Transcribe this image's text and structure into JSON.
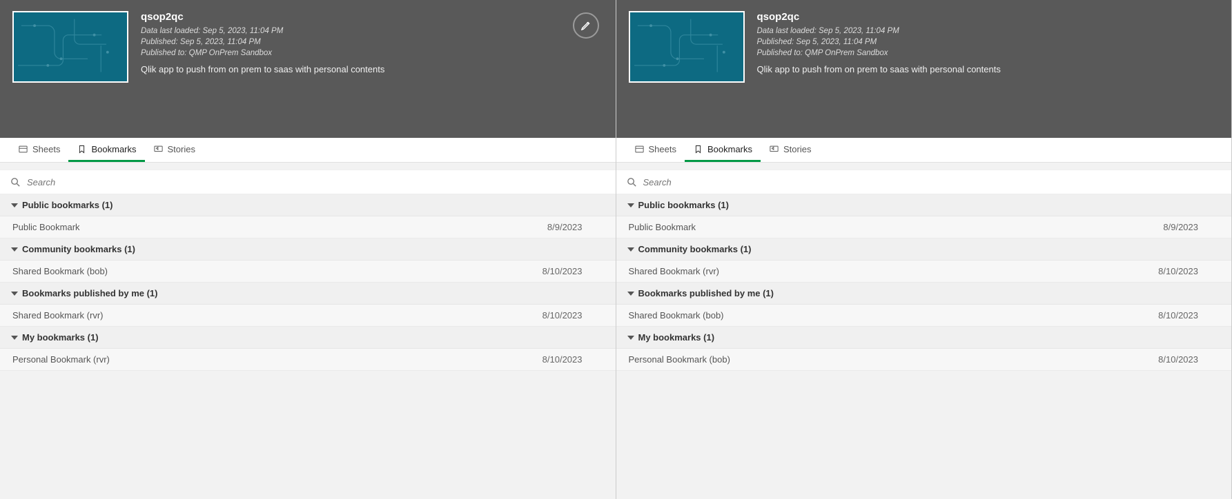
{
  "panels": [
    {
      "app": {
        "title": "qsop2qc",
        "loaded": "Data last loaded: Sep 5, 2023, 11:04 PM",
        "published": "Published: Sep 5, 2023, 11:04 PM",
        "published_to": "Published to: QMP OnPrem Sandbox",
        "desc": "Qlik app to push from on prem to saas with personal contents"
      },
      "show_edit": true,
      "tabs": {
        "sheets": "Sheets",
        "bookmarks": "Bookmarks",
        "stories": "Stories"
      },
      "search_placeholder": "Search",
      "sections": [
        {
          "title": "Public bookmarks (1)",
          "rows": [
            {
              "name": "Public Bookmark",
              "date": "8/9/2023"
            }
          ]
        },
        {
          "title": "Community bookmarks (1)",
          "rows": [
            {
              "name": "Shared Bookmark (bob)",
              "date": "8/10/2023"
            }
          ]
        },
        {
          "title": "Bookmarks published by me (1)",
          "rows": [
            {
              "name": "Shared Bookmark (rvr)",
              "date": "8/10/2023"
            }
          ]
        },
        {
          "title": "My bookmarks (1)",
          "rows": [
            {
              "name": "Personal Bookmark (rvr)",
              "date": "8/10/2023"
            }
          ]
        }
      ]
    },
    {
      "app": {
        "title": "qsop2qc",
        "loaded": "Data last loaded: Sep 5, 2023, 11:04 PM",
        "published": "Published: Sep 5, 2023, 11:04 PM",
        "published_to": "Published to: QMP OnPrem Sandbox",
        "desc": "Qlik app to push from on prem to saas with personal contents"
      },
      "show_edit": false,
      "tabs": {
        "sheets": "Sheets",
        "bookmarks": "Bookmarks",
        "stories": "Stories"
      },
      "search_placeholder": "Search",
      "sections": [
        {
          "title": "Public bookmarks (1)",
          "rows": [
            {
              "name": "Public Bookmark",
              "date": "8/9/2023"
            }
          ]
        },
        {
          "title": "Community bookmarks (1)",
          "rows": [
            {
              "name": "Shared Bookmark (rvr)",
              "date": "8/10/2023"
            }
          ]
        },
        {
          "title": "Bookmarks published by me (1)",
          "rows": [
            {
              "name": "Shared Bookmark (bob)",
              "date": "8/10/2023"
            }
          ]
        },
        {
          "title": "My bookmarks (1)",
          "rows": [
            {
              "name": "Personal Bookmark (bob)",
              "date": "8/10/2023"
            }
          ]
        }
      ]
    }
  ]
}
